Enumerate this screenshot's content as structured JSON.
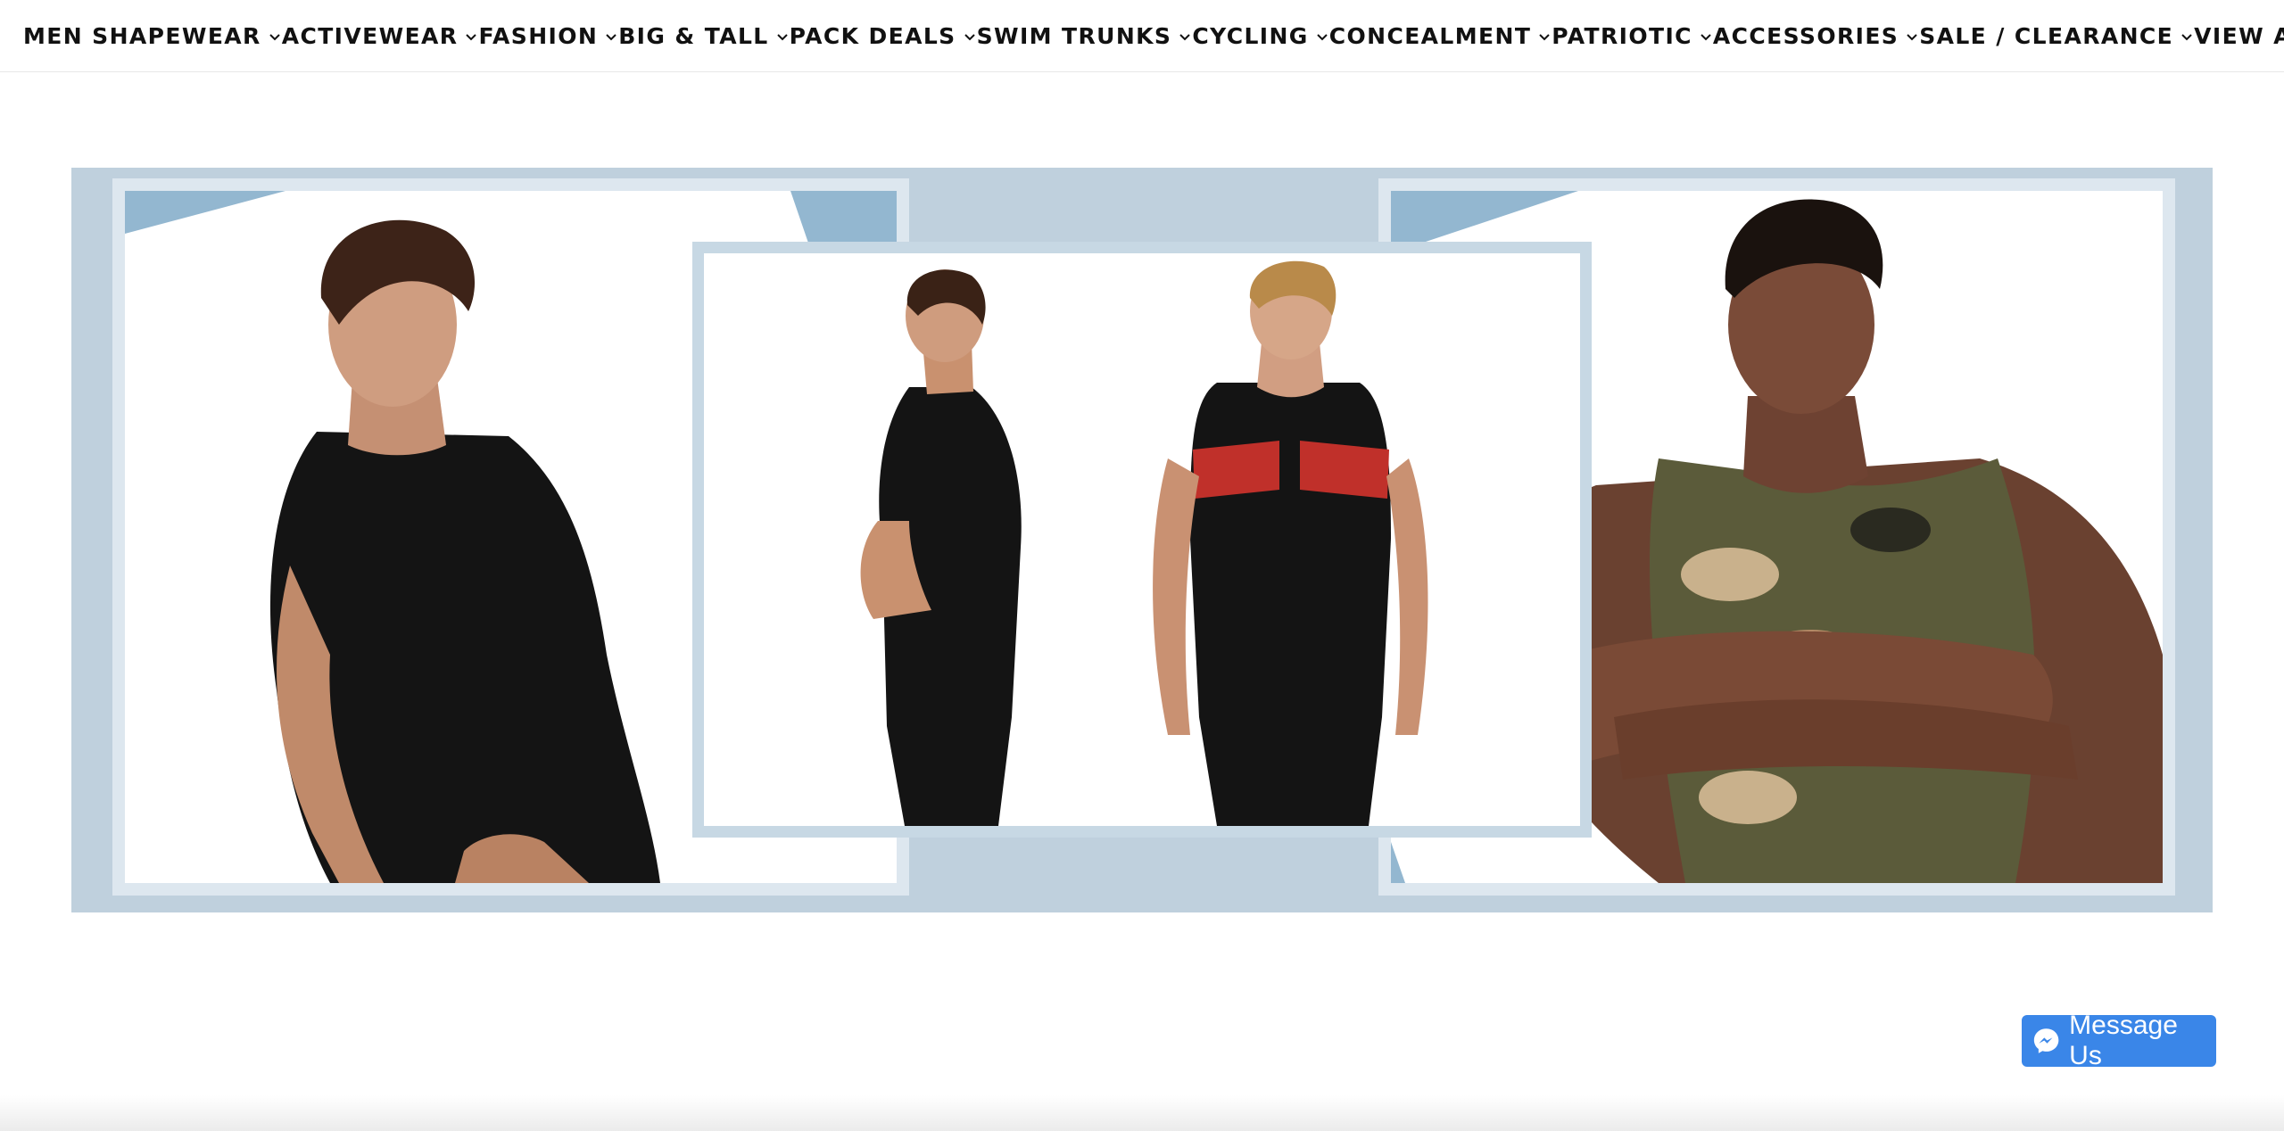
{
  "nav": {
    "items": [
      {
        "label": "MEN SHAPEWEAR"
      },
      {
        "label": "ACTIVEWEAR"
      },
      {
        "label": "FASHION"
      },
      {
        "label": "BIG & TALL"
      },
      {
        "label": "PACK DEALS"
      },
      {
        "label": "SWIM TRUNKS"
      },
      {
        "label": "CYCLING"
      },
      {
        "label": "CONCEALMENT"
      },
      {
        "label": "PATRIOTIC"
      },
      {
        "label": "ACCESSORIES"
      },
      {
        "label": "SALE / CLEARANCE"
      },
      {
        "label": "VIEW ALL"
      }
    ],
    "chevron_icon": "chevron-down-icon"
  },
  "banner": {
    "background_color": "#bfd0dd",
    "accent_color": "#93b7d0"
  },
  "message_button": {
    "label": "Message Us",
    "icon": "messenger-icon",
    "color": "#3a86e8"
  }
}
